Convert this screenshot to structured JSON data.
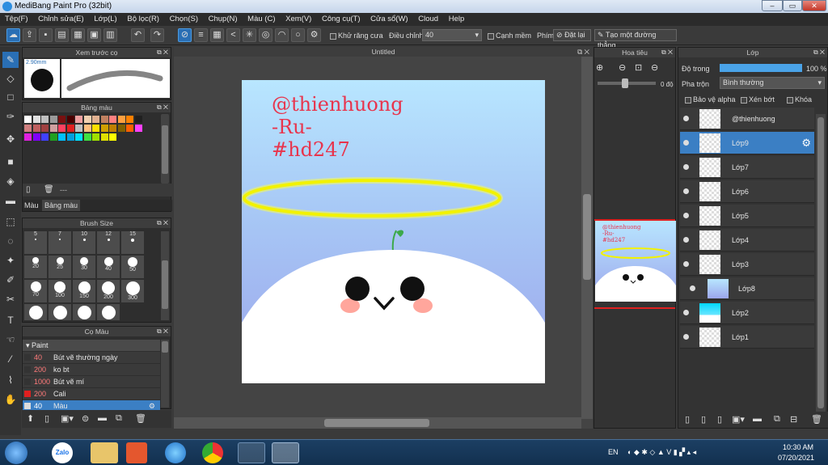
{
  "window": {
    "title": "MediBang Paint Pro (32bit)"
  },
  "menu": [
    "Tệp(F)",
    "Chỉnh sửa(E)",
    "Lớp(L)",
    "Bộ lọc(R)",
    "Chọn(S)",
    "Chụp(N)",
    "Màu (C)",
    "Xem(V)",
    "Công cụ(T)",
    "Cửa sổ(W)",
    "Cloud",
    "Help"
  ],
  "toolbar": {
    "antialias_label": "Khử răng cưa",
    "adjust_label": "Điều chỉnh",
    "adjust_value": "40",
    "canh_mem_label": "Cạnh mềm",
    "phim_label": "Phím",
    "reset_label": "Đặt lại",
    "line_label": "Tạo một đường thẳng"
  },
  "brush_preview": {
    "title": "Xem trước cọ",
    "size": "2.90mm"
  },
  "color_panel": {
    "title": "Bảng màu",
    "placeholder": "---",
    "tabs": [
      "Màu",
      "Bảng màu"
    ]
  },
  "brush_size": {
    "title": "Brush Size",
    "sizes": [
      "5",
      "7",
      "10",
      "12",
      "15",
      "20",
      "25",
      "30",
      "40",
      "50",
      "70",
      "100",
      "150",
      "200",
      "300"
    ]
  },
  "brush_list": {
    "title": "Cọ Màu",
    "group": "Paint",
    "items": [
      {
        "size": "40",
        "name": "Bút vẽ thường ngày",
        "color": "#333333"
      },
      {
        "size": "200",
        "name": "ko bt",
        "color": "#333333"
      },
      {
        "size": "1000",
        "name": "Bút vẽ mí",
        "color": "#333333"
      },
      {
        "size": "200",
        "name": "Cali",
        "color": "#e02020"
      },
      {
        "size": "40",
        "name": "Màu",
        "color": "#dddddd"
      }
    ]
  },
  "canvas": {
    "tab_title": "Untitled",
    "text_lines": [
      "@thienhuong",
      "-Ru-",
      "#hd247"
    ]
  },
  "navigator": {
    "title": "Hoa tiêu",
    "angle": "0 độ"
  },
  "layers_panel": {
    "title": "Lớp",
    "opacity_label": "Độ trong",
    "opacity_value": "100 %",
    "opacity_fraction": 1.0,
    "blend_label": "Pha trộn",
    "blend_value": "Bình thường",
    "protect_alpha": "Bảo vệ alpha",
    "clipping": "Xén bớt",
    "lock": "Khóa",
    "layers": [
      "@thienhuong",
      "Lớp9",
      "Lớp7",
      "Lớp6",
      "Lớp5",
      "Lớp4",
      "Lớp3",
      "Lớp8",
      "Lớp2",
      "Lớp1"
    ],
    "selected": "Lớp9"
  },
  "taskbar": {
    "lang": "EN",
    "time": "10:30 AM",
    "date": "07/20/2021",
    "zalo": "Zalo"
  }
}
